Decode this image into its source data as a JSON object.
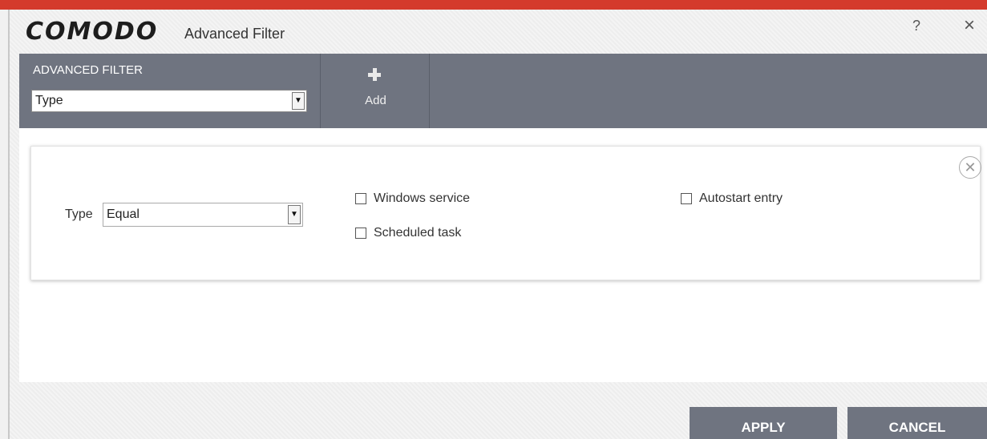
{
  "app": {
    "logo_text": "COMODO",
    "title": "Advanced Filter",
    "help_label": "?",
    "close_label": "×"
  },
  "toolbar": {
    "section_label": "ADVANCED FILTER",
    "filter_select_value": "Type",
    "add_label": "Add"
  },
  "condition": {
    "field_label": "Type",
    "operator_value": "Equal",
    "options": [
      {
        "label": "Windows service",
        "checked": false
      },
      {
        "label": "Scheduled task",
        "checked": false
      },
      {
        "label": "Autostart entry",
        "checked": false
      }
    ]
  },
  "footer": {
    "apply_label": "APPLY",
    "cancel_label": "CANCEL"
  },
  "colors": {
    "accent_red": "#d43a2c",
    "toolbar_gray": "#6f7480"
  }
}
